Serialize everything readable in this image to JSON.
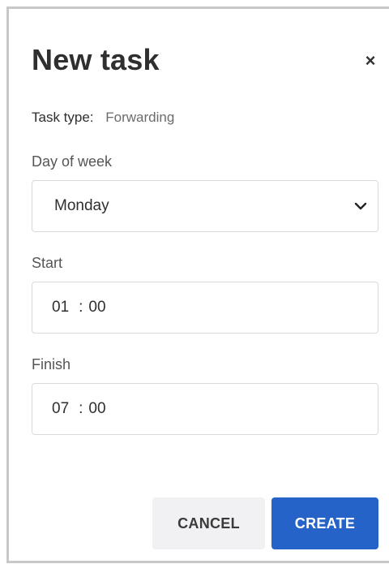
{
  "dialog": {
    "title": "New task",
    "close_icon": "close-icon"
  },
  "task_type": {
    "label": "Task type:",
    "value": "Forwarding"
  },
  "day_of_week": {
    "label": "Day of week",
    "selected": "Monday"
  },
  "start": {
    "label": "Start",
    "hours": "01",
    "separator": ":",
    "minutes": "00"
  },
  "finish": {
    "label": "Finish",
    "hours": "07",
    "separator": ":",
    "minutes": "00"
  },
  "actions": {
    "cancel_label": "CANCEL",
    "create_label": "CREATE"
  },
  "colors": {
    "primary": "#2563c9",
    "secondary_bg": "#f1f1f3",
    "border": "#d9d9d9"
  }
}
